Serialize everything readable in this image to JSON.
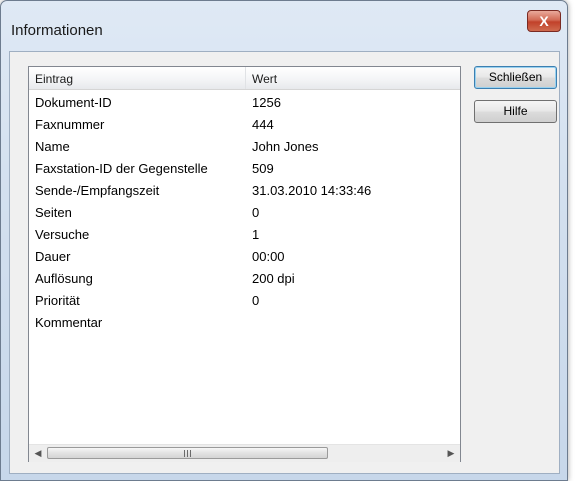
{
  "window": {
    "title": "Informationen",
    "close_glyph": "X"
  },
  "table": {
    "columns": [
      "Eintrag",
      "Wert"
    ],
    "rows": [
      {
        "key": "Dokument-ID",
        "value": "1256"
      },
      {
        "key": "Faxnummer",
        "value": "444"
      },
      {
        "key": "Name",
        "value": "John Jones"
      },
      {
        "key": "Faxstation-ID der Gegenstelle",
        "value": "509"
      },
      {
        "key": "Sende-/Empfangszeit",
        "value": "31.03.2010 14:33:46"
      },
      {
        "key": "Seiten",
        "value": "0"
      },
      {
        "key": "Versuche",
        "value": "1"
      },
      {
        "key": "Dauer",
        "value": "00:00"
      },
      {
        "key": "Auflösung",
        "value": "200 dpi"
      },
      {
        "key": "Priorität",
        "value": "0"
      },
      {
        "key": "Kommentar",
        "value": ""
      }
    ]
  },
  "buttons": {
    "close": "Schließen",
    "help": "Hilfe"
  },
  "scrollbar": {
    "left_arrow": "◀",
    "right_arrow": "▶"
  },
  "colors": {
    "close_button_red": "#c1412a",
    "frame_blue": "#c7d7ea"
  }
}
